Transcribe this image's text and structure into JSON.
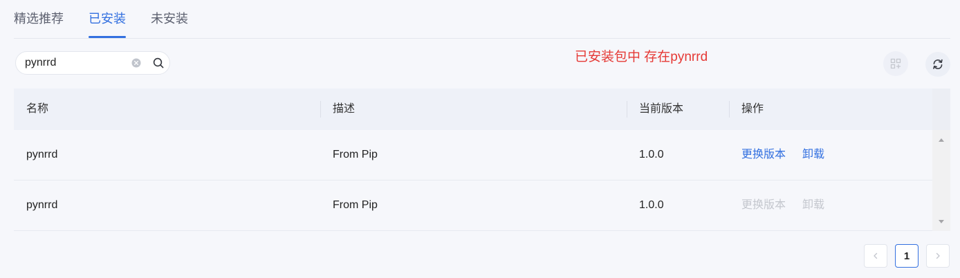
{
  "colors": {
    "accent": "#3370e0",
    "notice": "#e53935",
    "disabled": "#c4c7ce",
    "background": "#f6f7fb"
  },
  "tabs": [
    {
      "label": "精选推荐",
      "active": false
    },
    {
      "label": "已安装",
      "active": true
    },
    {
      "label": "未安装",
      "active": false
    }
  ],
  "search": {
    "value": "pynrrd",
    "clear_icon": "clear-icon",
    "search_icon": "search-icon"
  },
  "notice": "已安装包中 存在pynrrd",
  "toolbar": {
    "install_button": {
      "icon": "apps-add-icon",
      "enabled": false
    },
    "refresh_button": {
      "icon": "refresh-icon",
      "enabled": true
    }
  },
  "table": {
    "columns": [
      "名称",
      "描述",
      "当前版本",
      "操作"
    ],
    "rows": [
      {
        "name": "pynrrd",
        "description": "From Pip",
        "version": "1.0.0",
        "actions": [
          "更换版本",
          "卸载"
        ],
        "actions_enabled": true
      },
      {
        "name": "pynrrd",
        "description": "From Pip",
        "version": "1.0.0",
        "actions": [
          "更换版本",
          "卸载"
        ],
        "actions_enabled": false
      }
    ],
    "scrollbar": {
      "up_icon": "scroll-up-icon",
      "down_icon": "scroll-down-icon"
    }
  },
  "pagination": {
    "current_page": "1",
    "prev_icon": "chevron-left-icon",
    "next_icon": "chevron-right-icon",
    "prev_enabled": false,
    "next_enabled": false
  }
}
